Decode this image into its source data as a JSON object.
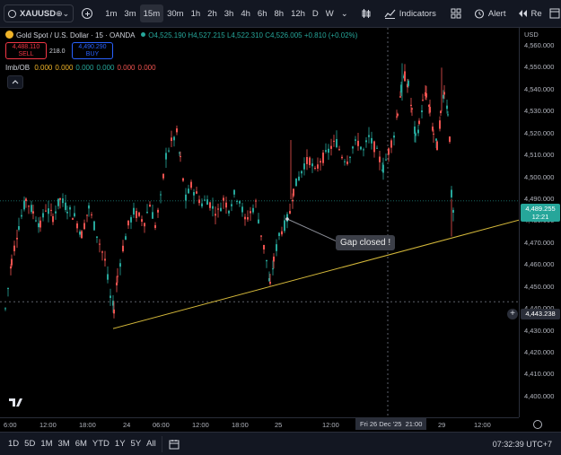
{
  "toolbar": {
    "symbol": "XAUUSD",
    "timeframes": [
      "1m",
      "3m",
      "15m",
      "30m",
      "1h",
      "2h",
      "3h",
      "4h",
      "6h",
      "8h",
      "12h",
      "D",
      "W"
    ],
    "active_timeframe": "15m",
    "indicators_label": "Indicators",
    "alert_label": "Alert",
    "replay_label": "Re"
  },
  "legend": {
    "title": "Gold Spot / U.S. Dollar · 15 · OANDA",
    "o": "O4,525.190",
    "h": "H4,527.215",
    "l": "L4,522.310",
    "c": "C4,526.005",
    "chg": "+0.810 (+0.02%)"
  },
  "trade": {
    "sell_price": "4,488.110",
    "sell_label": "SELL",
    "spread": "218.0",
    "buy_price": "4,490.290",
    "buy_label": "BUY"
  },
  "indicator": {
    "name": "Imb/OB",
    "values": [
      "0.000",
      "0.000",
      "0.000",
      "0.000",
      "0.000",
      "0.000"
    ],
    "colors": [
      "#f0b429",
      "#f0b429",
      "#26a69a",
      "#26a69a",
      "#ef5350",
      "#ef5350"
    ]
  },
  "price_axis": {
    "currency": "USD",
    "ticks": [
      "4,560.000",
      "4,550.000",
      "4,540.000",
      "4,530.000",
      "4,520.000",
      "4,510.000",
      "4,500.000",
      "4,490.000",
      "4,480.000",
      "4,470.000",
      "4,460.000",
      "4,450.000",
      "4,440.000",
      "4,430.000",
      "4,420.000",
      "4,410.000",
      "4,400.000"
    ],
    "last_price": "4,489.255",
    "countdown": "12:21",
    "crosshair_price": "4,443.238"
  },
  "time_axis": {
    "ticks": [
      "6:00",
      "12:00",
      "18:00",
      "24",
      "06:00",
      "12:00",
      "18:00",
      "25",
      "12:00",
      "29",
      "12:00"
    ],
    "crosshair_label": "Fri 26 Dec '25",
    "crosshair_time": "21:00"
  },
  "annotation": {
    "text": "Gap closed !"
  },
  "bottom": {
    "ranges": [
      "1D",
      "5D",
      "1M",
      "3M",
      "6M",
      "YTD",
      "1Y",
      "5Y",
      "All"
    ],
    "clock": "07:32:39 UTC+7"
  },
  "colors": {
    "up": "#26a69a",
    "down": "#ef5350",
    "trendline": "#d4b83a"
  }
}
